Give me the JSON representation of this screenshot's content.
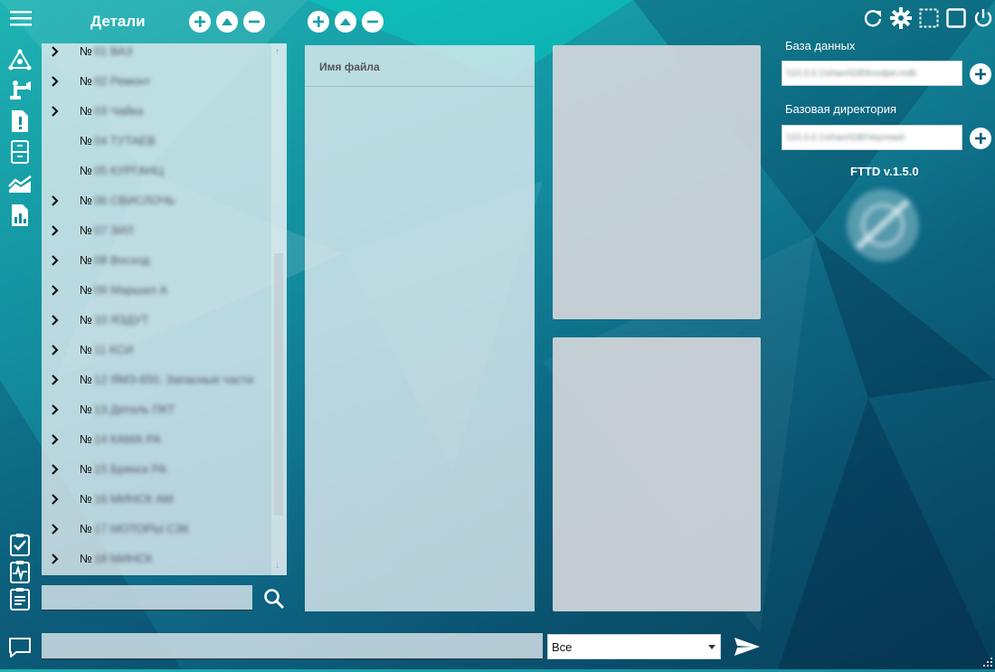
{
  "header": {
    "title": "Детали"
  },
  "tree": {
    "items": [
      {
        "num": "№",
        "name": "01 ВАЗ",
        "expandable": true
      },
      {
        "num": "№",
        "name": "02 Ремонт",
        "expandable": true
      },
      {
        "num": "№",
        "name": "03 Чайка",
        "expandable": true
      },
      {
        "num": "№",
        "name": "04 ТУТАЕВ",
        "expandable": false
      },
      {
        "num": "№",
        "name": "05 КУРГАНЦ",
        "expandable": false
      },
      {
        "num": "№",
        "name": "06 СВИСЛОЧЬ",
        "expandable": true
      },
      {
        "num": "№",
        "name": "07 ЗИЛ",
        "expandable": true
      },
      {
        "num": "№",
        "name": "08 Восход",
        "expandable": true
      },
      {
        "num": "№",
        "name": "09 Маршал А",
        "expandable": true
      },
      {
        "num": "№",
        "name": "10 ЯЗДУТ",
        "expandable": true
      },
      {
        "num": "№",
        "name": "11 КСИ",
        "expandable": true
      },
      {
        "num": "№",
        "name": "12 ЯМЗ-650. Запасные части",
        "expandable": true
      },
      {
        "num": "№",
        "name": "13 Деталь ПКТ",
        "expandable": true
      },
      {
        "num": "№",
        "name": "14 КАМА РА",
        "expandable": true
      },
      {
        "num": "№",
        "name": "15 Брянск РА",
        "expandable": true
      },
      {
        "num": "№",
        "name": "16 МИНСК АМ",
        "expandable": true
      },
      {
        "num": "№",
        "name": "17 МОТОРЫ СЗК",
        "expandable": true
      },
      {
        "num": "№",
        "name": "18 МИНСК",
        "expandable": true
      }
    ],
    "search_value": ""
  },
  "files": {
    "column_header": "Имя файла"
  },
  "settings": {
    "db_label": "База данных",
    "db_value": "\\\\10.0.0.1\\share\\DB\\Конфиг.mdb",
    "basedir_label": "Базовая директория",
    "basedir_value": "\\\\10.0.0.1\\share\\DB\\Чертежи\\",
    "version": "FTTD v.1.5.0"
  },
  "bottom": {
    "message_value": "",
    "filter_selected": "Все"
  },
  "icons": {
    "menu": "hamburger-icon",
    "refresh": "refresh-icon",
    "settings": "gear-icon",
    "select": "selection-icon",
    "maximize": "maximize-icon",
    "power": "power-icon"
  },
  "colors": {
    "accent": "#1fb3b3",
    "panel": "#dfeaee",
    "dark_bg": "#0c5c7b",
    "icon": "#ffffff"
  }
}
